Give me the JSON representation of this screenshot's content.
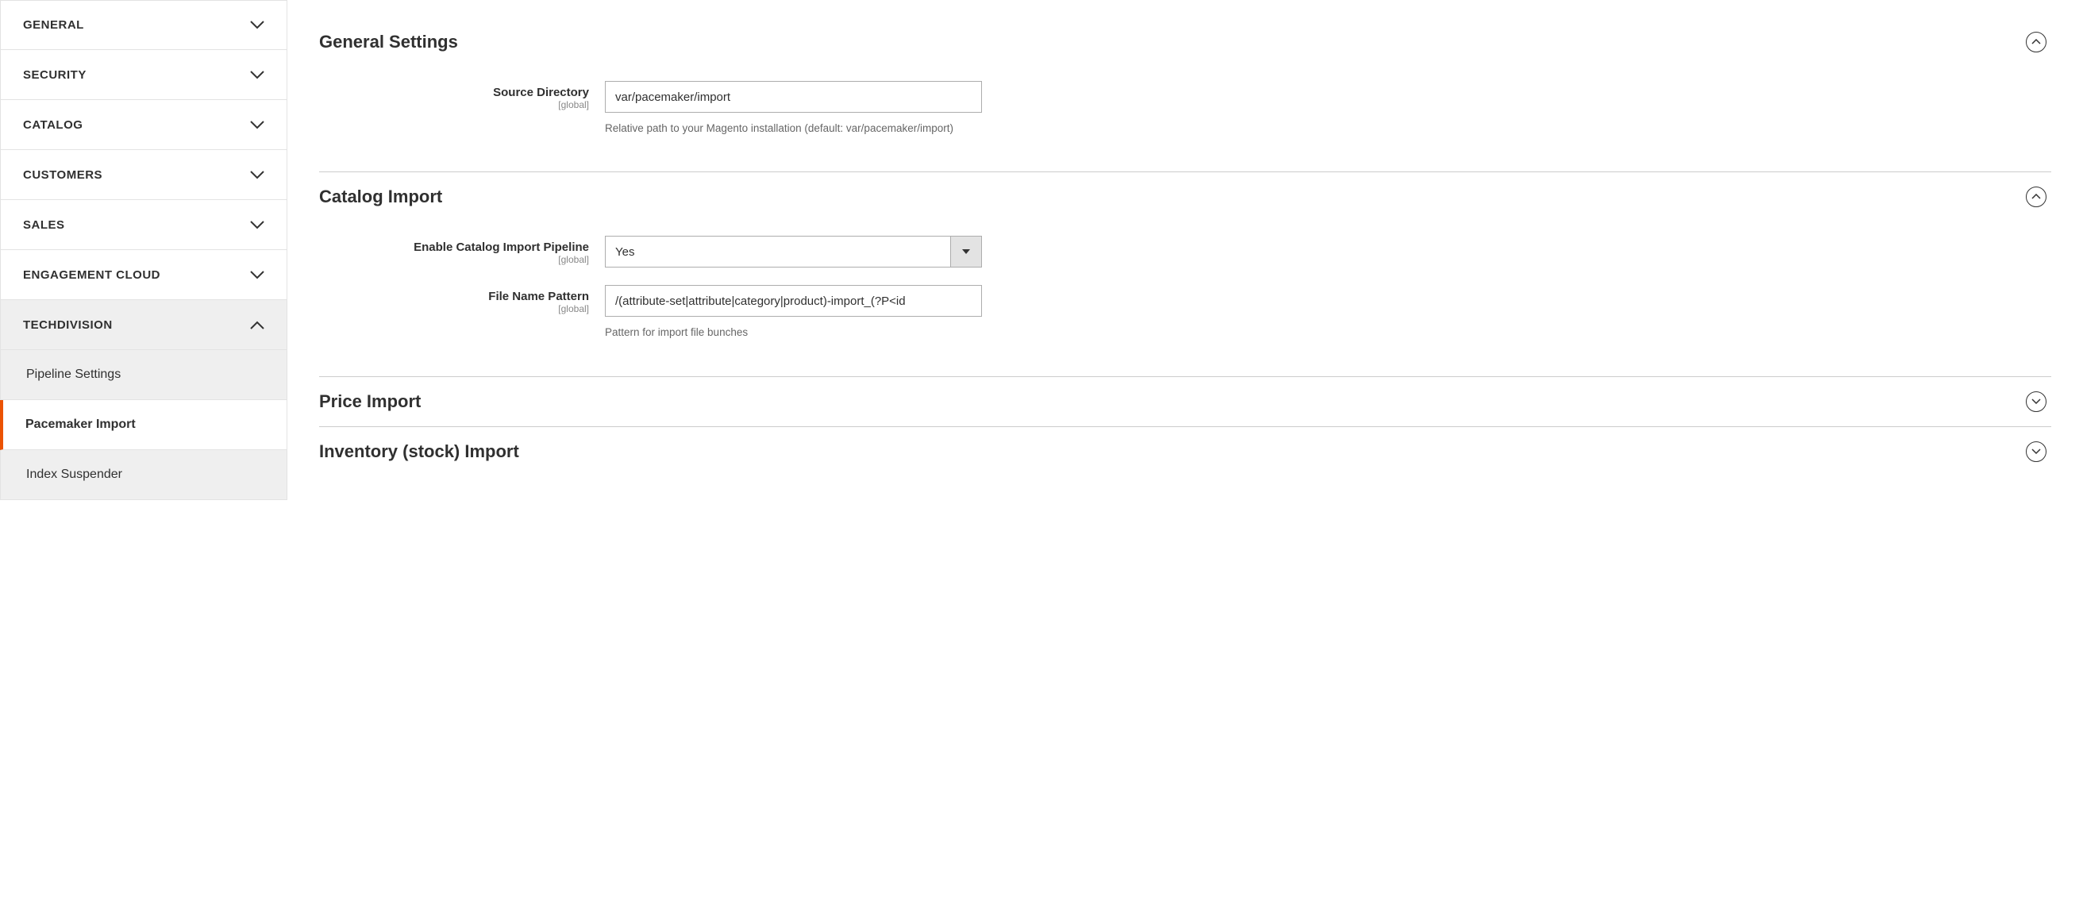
{
  "sidebar": {
    "items": [
      {
        "label": "GENERAL",
        "expanded": false
      },
      {
        "label": "SECURITY",
        "expanded": false
      },
      {
        "label": "CATALOG",
        "expanded": false
      },
      {
        "label": "CUSTOMERS",
        "expanded": false
      },
      {
        "label": "SALES",
        "expanded": false
      },
      {
        "label": "ENGAGEMENT CLOUD",
        "expanded": false
      },
      {
        "label": "TECHDIVISION",
        "expanded": true
      }
    ],
    "sub_items": [
      {
        "label": "Pipeline Settings",
        "active": false
      },
      {
        "label": "Pacemaker Import",
        "active": true
      },
      {
        "label": "Index Suspender",
        "active": false
      }
    ]
  },
  "sections": {
    "general_settings": {
      "title": "General Settings",
      "expanded": true,
      "fields": {
        "source_directory": {
          "label": "Source Directory",
          "scope": "[global]",
          "value": "var/pacemaker/import",
          "note": "Relative path to your Magento installation (default: var/pacemaker/import)"
        }
      }
    },
    "catalog_import": {
      "title": "Catalog Import",
      "expanded": true,
      "fields": {
        "enable_pipeline": {
          "label": "Enable Catalog Import Pipeline",
          "scope": "[global]",
          "value": "Yes"
        },
        "file_name_pattern": {
          "label": "File Name Pattern",
          "scope": "[global]",
          "value": "/(attribute-set|attribute|category|product)-import_(?P<id",
          "note": "Pattern for import file bunches"
        }
      }
    },
    "price_import": {
      "title": "Price Import",
      "expanded": false
    },
    "inventory_import": {
      "title": "Inventory (stock) Import",
      "expanded": false
    }
  }
}
